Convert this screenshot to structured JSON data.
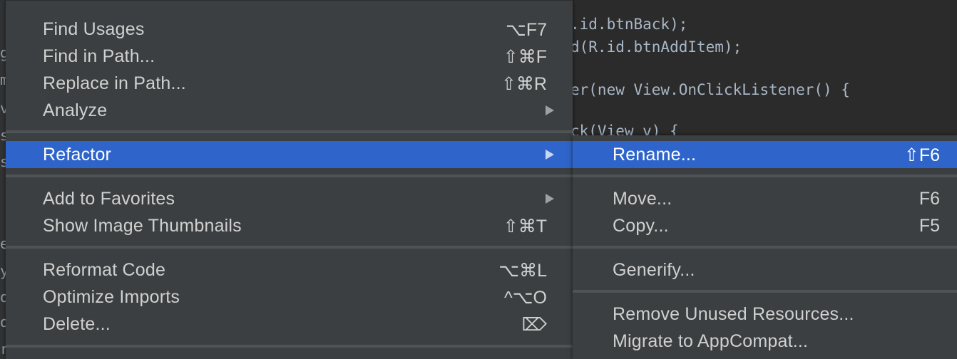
{
  "editor": {
    "code_lines": [
      ".id.btnBack);",
      "d(R.id.btnAddItem);",
      "",
      "er(new View.OnClickListener() {",
      "",
      "ck(View v) {"
    ],
    "gutter_chars": [
      "g",
      "m",
      "v",
      "s",
      "s",
      "e",
      "e",
      "y",
      "o",
      "o",
      "r"
    ]
  },
  "main_menu": {
    "items": [
      {
        "label": "Find Usages",
        "shortcut": "⌥F7"
      },
      {
        "label": "Find in Path...",
        "shortcut": "⇧⌘F"
      },
      {
        "label": "Replace in Path...",
        "shortcut": "⇧⌘R"
      },
      {
        "label": "Analyze",
        "shortcut": ""
      },
      {
        "label": "Refactor",
        "shortcut": ""
      },
      {
        "label": "Add to Favorites",
        "shortcut": ""
      },
      {
        "label": "Show Image Thumbnails",
        "shortcut": "⇧⌘T"
      },
      {
        "label": "Reformat Code",
        "shortcut": "⌥⌘L"
      },
      {
        "label": "Optimize Imports",
        "shortcut": "^⌥O"
      },
      {
        "label": "Delete...",
        "shortcut": "⌦"
      }
    ]
  },
  "refactor_submenu": {
    "items": [
      {
        "label": "Rename...",
        "shortcut": "⇧F6"
      },
      {
        "label": "Move...",
        "shortcut": "F6"
      },
      {
        "label": "Copy...",
        "shortcut": "F5"
      },
      {
        "label": "Generify...",
        "shortcut": ""
      },
      {
        "label": "Remove Unused Resources...",
        "shortcut": ""
      },
      {
        "label": "Migrate to AppCompat...",
        "shortcut": ""
      }
    ]
  },
  "colors": {
    "selection": "#2f65ca",
    "menu_bg": "#3c3f41",
    "editor_bg": "#2b2b2b"
  }
}
